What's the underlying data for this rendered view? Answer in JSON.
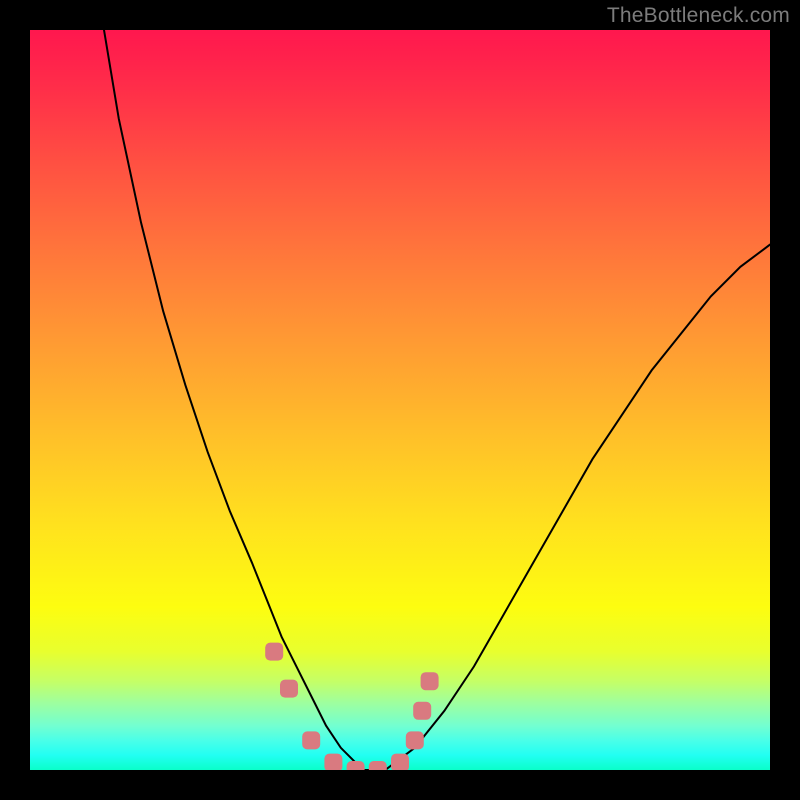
{
  "watermark": "TheBottleneck.com",
  "chart_data": {
    "type": "line",
    "title": "",
    "xlabel": "",
    "ylabel": "",
    "xlim": [
      0,
      100
    ],
    "ylim": [
      0,
      100
    ],
    "grid": false,
    "series": [
      {
        "name": "curve",
        "x": [
          10,
          12,
          15,
          18,
          21,
          24,
          27,
          30,
          32,
          34,
          36,
          38,
          40,
          42,
          45,
          48,
          52,
          56,
          60,
          64,
          68,
          72,
          76,
          80,
          84,
          88,
          92,
          96,
          100
        ],
        "y": [
          100,
          88,
          74,
          62,
          52,
          43,
          35,
          28,
          23,
          18,
          14,
          10,
          6,
          3,
          0,
          0,
          3,
          8,
          14,
          21,
          28,
          35,
          42,
          48,
          54,
          59,
          64,
          68,
          71
        ],
        "color": "#000000"
      },
      {
        "name": "highlight-markers",
        "x": [
          33,
          35,
          38,
          41,
          44,
          47,
          50,
          52,
          53,
          54
        ],
        "y": [
          16,
          11,
          4,
          1,
          0,
          0,
          1,
          4,
          8,
          12
        ],
        "color": "#d97a80",
        "marker": "square"
      }
    ],
    "background_gradient": {
      "stops": [
        {
          "pos": 0.0,
          "color": "#ff174e"
        },
        {
          "pos": 0.18,
          "color": "#ff5042"
        },
        {
          "pos": 0.42,
          "color": "#ff9a33"
        },
        {
          "pos": 0.67,
          "color": "#ffe21e"
        },
        {
          "pos": 0.84,
          "color": "#e8ff2e"
        },
        {
          "pos": 0.94,
          "color": "#73ffd0"
        },
        {
          "pos": 1.0,
          "color": "#0affc9"
        }
      ]
    }
  }
}
